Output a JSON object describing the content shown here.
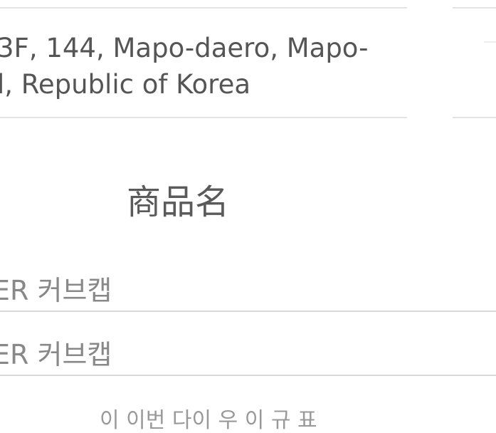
{
  "address": {
    "line1": "3F, 144, Mapo-daero, Mapo-",
    "line2": "l, Republic of Korea"
  },
  "product_section": {
    "title": "商品名",
    "items": [
      {
        "name": "ER 커브캡"
      },
      {
        "name": "ER 커브캡"
      }
    ]
  },
  "footer_partial_text": "이 이번 다이 우 이 규 표"
}
